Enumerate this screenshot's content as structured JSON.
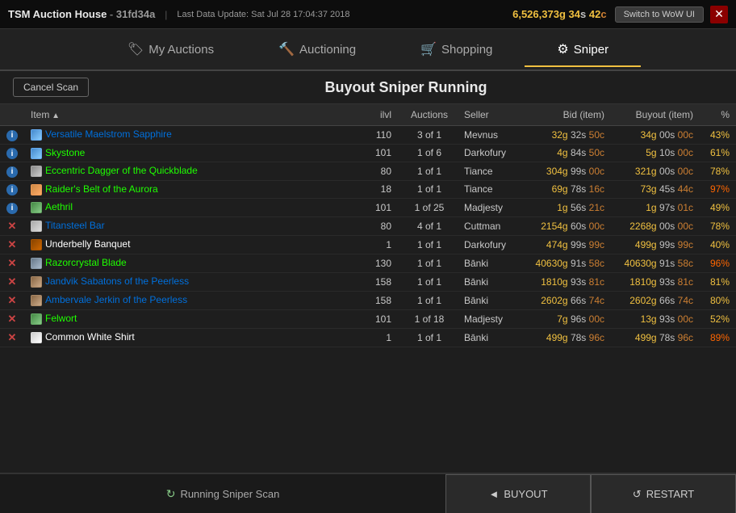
{
  "titleBar": {
    "appName": "TSM Auction House",
    "serverId": "31fd34a",
    "separator": "|",
    "lastUpdate": "Last Data Update: Sat Jul 28 17:04:37 2018",
    "gold": "6,526,373",
    "silver": "34",
    "copper": "42",
    "switchBtn": "Switch to WoW UI",
    "closeBtn": "✕"
  },
  "nav": {
    "tabs": [
      {
        "id": "my-auctions",
        "label": "My Auctions",
        "icon": "🏷",
        "active": false
      },
      {
        "id": "auctioning",
        "label": "Auctioning",
        "icon": "🔨",
        "active": false
      },
      {
        "id": "shopping",
        "label": "Shopping",
        "icon": "🛒",
        "active": false
      },
      {
        "id": "sniper",
        "label": "Sniper",
        "icon": "⚙",
        "active": true
      }
    ]
  },
  "scanHeader": {
    "cancelBtn": "Cancel Scan",
    "title": "Buyout Sniper Running"
  },
  "table": {
    "columns": [
      {
        "id": "status",
        "label": ""
      },
      {
        "id": "item",
        "label": "Item",
        "sortActive": true
      },
      {
        "id": "ilvl",
        "label": "ilvl"
      },
      {
        "id": "auctions",
        "label": "Auctions"
      },
      {
        "id": "seller",
        "label": "Seller"
      },
      {
        "id": "bid",
        "label": "Bid (item)",
        "alignRight": true
      },
      {
        "id": "buyout",
        "label": "Buyout (item)",
        "alignRight": true
      },
      {
        "id": "pct",
        "label": "%",
        "alignRight": true
      }
    ],
    "rows": [
      {
        "status": "i",
        "statusType": "info",
        "item": "Versatile Maelstrom Sapphire",
        "itemColor": "rare",
        "itemIcon": "gem",
        "ilvl": "110",
        "auctions": "3 of 1",
        "seller": "Mevnus",
        "bid": "32g 32s 50c",
        "bidG": "32",
        "bidS": "32",
        "bidC": "50",
        "buyout": "34g 00s 00c",
        "buyG": "34",
        "buyS": "00",
        "buyC": "00",
        "pct": "43%",
        "pctClass": "pct-yellow"
      },
      {
        "status": "i",
        "statusType": "info",
        "item": "Skystone",
        "itemColor": "uncommon",
        "itemIcon": "gem",
        "ilvl": "101",
        "auctions": "1 of 6",
        "seller": "Darkofury",
        "bid": "4g 84s 50c",
        "bidG": "4",
        "bidS": "84",
        "bidC": "50",
        "buyout": "5g 10s 00c",
        "buyG": "5",
        "buyS": "10",
        "buyC": "00",
        "pct": "61%",
        "pctClass": "pct-yellow"
      },
      {
        "status": "i",
        "statusType": "info",
        "item": "Eccentric Dagger of the Quickblade",
        "itemColor": "uncommon",
        "itemIcon": "dagger",
        "ilvl": "80",
        "auctions": "1 of 1",
        "seller": "Tiance",
        "bid": "304g 99s 00c",
        "bidG": "304",
        "bidS": "99",
        "bidC": "00",
        "buyout": "321g 00s 00c",
        "buyG": "321",
        "buyS": "00",
        "buyC": "00",
        "pct": "78%",
        "pctClass": "pct-yellow"
      },
      {
        "status": "i",
        "statusType": "info",
        "item": "Raider's Belt of the Aurora",
        "itemColor": "uncommon",
        "itemIcon": "belt",
        "ilvl": "18",
        "auctions": "1 of 1",
        "seller": "Tiance",
        "bid": "69g 78s 16c",
        "bidG": "69",
        "bidS": "78",
        "bidC": "16",
        "buyout": "73g 45s 44c",
        "buyG": "73",
        "buyS": "45",
        "buyC": "44",
        "pct": "97%",
        "pctClass": "pct-orange"
      },
      {
        "status": "i",
        "statusType": "info",
        "item": "Aethril",
        "itemColor": "uncommon",
        "itemIcon": "herb",
        "ilvl": "101",
        "auctions": "1 of 25",
        "seller": "Madjesty",
        "bid": "1g 56s 21c",
        "bidG": "1",
        "bidS": "56",
        "bidC": "21",
        "buyout": "1g 97s 01c",
        "buyG": "1",
        "buyS": "97",
        "buyC": "01",
        "pct": "49%",
        "pctClass": "pct-yellow"
      },
      {
        "status": "x",
        "statusType": "x",
        "item": "Titansteel Bar",
        "itemColor": "rare",
        "itemIcon": "bar",
        "ilvl": "80",
        "auctions": "4 of 1",
        "seller": "Cuttman",
        "bid": "2154g 60s 00c",
        "bidG": "2154",
        "bidS": "60",
        "bidC": "00",
        "buyout": "2268g 00s 00c",
        "buyG": "2268",
        "buyS": "00",
        "buyC": "00",
        "pct": "78%",
        "pctClass": "pct-yellow"
      },
      {
        "status": "x",
        "statusType": "x",
        "item": "Underbelly Banquet",
        "itemColor": "common",
        "itemIcon": "food",
        "ilvl": "1",
        "auctions": "1 of 1",
        "seller": "Darkofury",
        "bid": "474g 99s 99c",
        "bidG": "474",
        "bidS": "99",
        "bidC": "99",
        "buyout": "499g 99s 99c",
        "buyG": "499",
        "buyS": "99",
        "buyC": "99",
        "pct": "40%",
        "pctClass": "pct-yellow"
      },
      {
        "status": "x",
        "statusType": "x",
        "item": "Razorcrystal Blade",
        "itemColor": "uncommon",
        "itemIcon": "sword",
        "ilvl": "130",
        "auctions": "1 of 1",
        "seller": "Bānki",
        "bid": "40630g 91s 58c",
        "bidG": "40630",
        "bidS": "91",
        "bidC": "58",
        "buyout": "40630g 91s 58c",
        "buyG": "40630",
        "buyS": "91",
        "buyC": "58",
        "pct": "96%",
        "pctClass": "pct-orange"
      },
      {
        "status": "x",
        "statusType": "x",
        "item": "Jandvik Sabatons of the Peerless",
        "itemColor": "rare",
        "itemIcon": "boot",
        "ilvl": "158",
        "auctions": "1 of 1",
        "seller": "Bānki",
        "bid": "1810g 93s 81c",
        "bidG": "1810",
        "bidS": "93",
        "bidC": "81",
        "buyout": "1810g 93s 81c",
        "buyG": "1810",
        "buyS": "93",
        "buyC": "81",
        "pct": "81%",
        "pctClass": "pct-yellow"
      },
      {
        "status": "x",
        "statusType": "x",
        "item": "Ambervale Jerkin of the Peerless",
        "itemColor": "rare",
        "itemIcon": "chest",
        "ilvl": "158",
        "auctions": "1 of 1",
        "seller": "Bānki",
        "bid": "2602g 66s 74c",
        "bidG": "2602",
        "bidS": "66",
        "bidC": "74",
        "buyout": "2602g 66s 74c",
        "buyG": "2602",
        "buyS": "66",
        "buyC": "74",
        "pct": "80%",
        "pctClass": "pct-yellow"
      },
      {
        "status": "x",
        "statusType": "x",
        "item": "Felwort",
        "itemColor": "uncommon",
        "itemIcon": "herb",
        "ilvl": "101",
        "auctions": "1 of 18",
        "seller": "Madjesty",
        "bid": "7g 96s 00c",
        "bidG": "7",
        "bidS": "96",
        "bidC": "00",
        "buyout": "13g 93s 00c",
        "buyG": "13",
        "buyS": "93",
        "buyC": "00",
        "pct": "52%",
        "pctClass": "pct-yellow"
      },
      {
        "status": "x",
        "statusType": "x",
        "item": "Common White Shirt",
        "itemColor": "common",
        "itemIcon": "shirt",
        "ilvl": "1",
        "auctions": "1 of 1",
        "seller": "Bānki",
        "bid": "499g 78s 96c",
        "bidG": "499",
        "bidS": "78",
        "bidC": "96",
        "buyout": "499g 78s 96c",
        "buyG": "499",
        "buyS": "78",
        "buyC": "96",
        "pct": "89%",
        "pctClass": "pct-orange"
      }
    ]
  },
  "bottomBar": {
    "runningLabel": "Running Sniper Scan",
    "buyoutBtn": "BUYOUT",
    "restartBtn": "RESTART"
  }
}
